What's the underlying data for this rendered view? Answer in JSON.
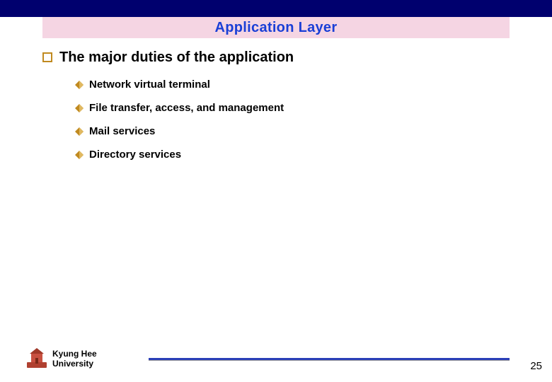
{
  "title": "Application Layer",
  "heading": "The major duties of  the application",
  "items": [
    "Network virtual terminal",
    "File transfer, access, and management",
    "Mail services",
    "Directory services"
  ],
  "university": {
    "line1": "Kyung Hee",
    "line2": "University"
  },
  "page_number": "25",
  "colors": {
    "top_band": "#00006e",
    "title_bg": "#f5d5e3",
    "title_fg": "#1a3fd6",
    "bullet_outline": "#c08a20",
    "diamond_fill": "#c08a20",
    "footer_rule": "#2b3fb8"
  }
}
